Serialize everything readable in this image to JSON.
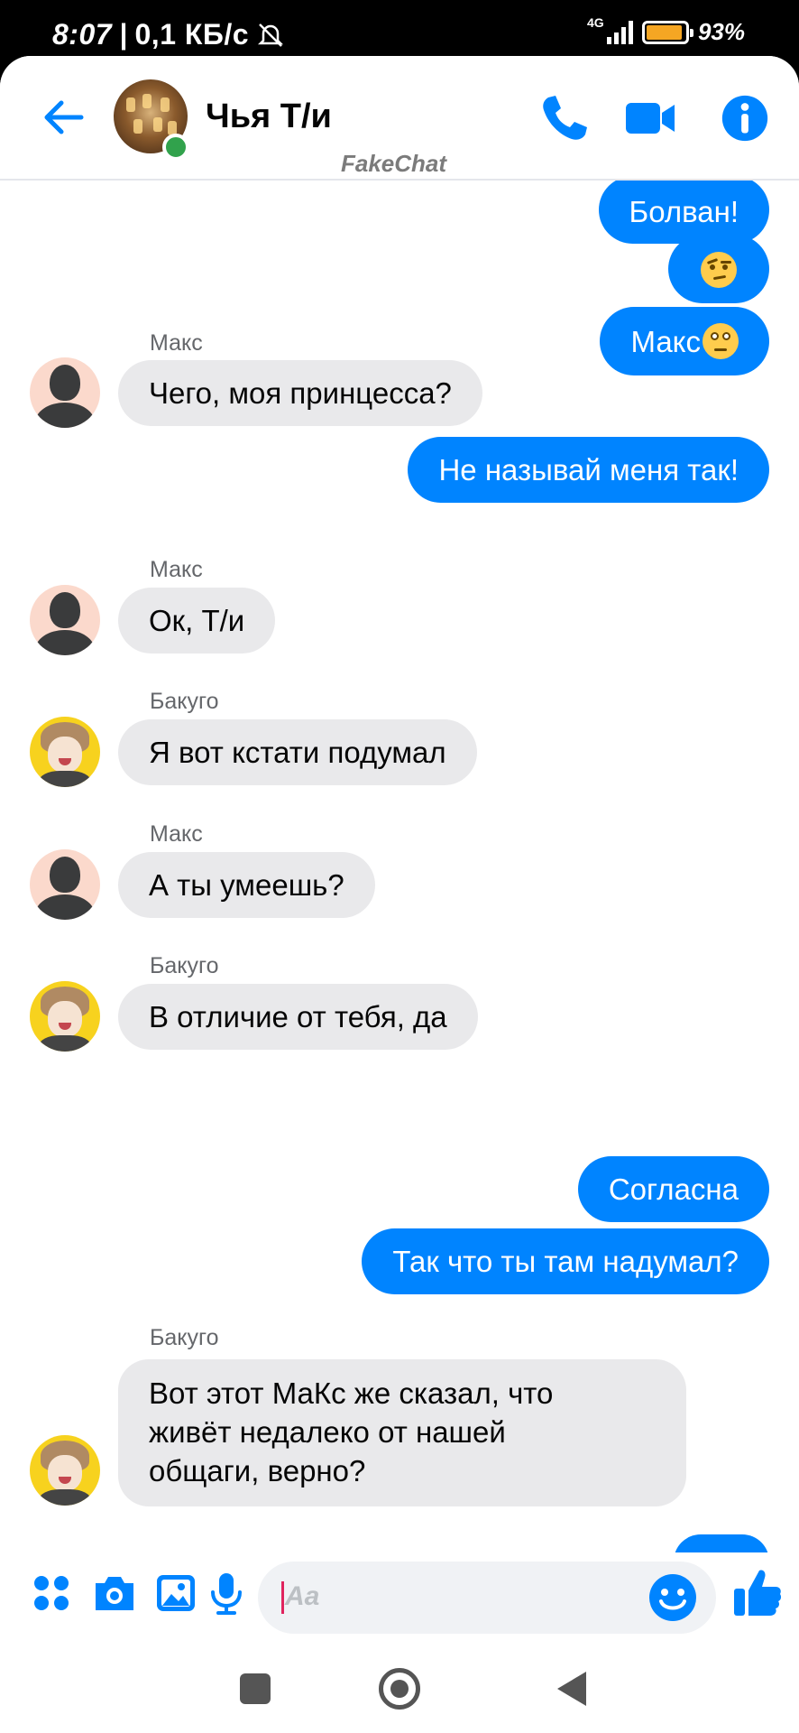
{
  "status_bar": {
    "time": "8:07",
    "network_speed": "0,1 КБ/с",
    "network_type": "4G",
    "battery_percent": "93%",
    "battery_level": 0.93,
    "battery_color": "#f5a623"
  },
  "header": {
    "title": "Чья Т/и",
    "watermark": "FakeChat",
    "online": true,
    "icons": [
      "back-arrow-icon",
      "phone-icon",
      "video-camera-icon",
      "info-icon"
    ]
  },
  "colors": {
    "accent": "#0084ff",
    "incoming_bubble": "#e9e9eb",
    "online_dot": "#31a24c"
  },
  "messages": [
    {
      "dir": "out",
      "text": "Болван!"
    },
    {
      "dir": "out",
      "emoji": "raised-eyebrow-emoji"
    },
    {
      "dir": "out",
      "text": "Макс",
      "emoji": "eye-roll-emoji"
    },
    {
      "dir": "in",
      "sender": "Макс",
      "text": "Чего, моя принцесса?"
    },
    {
      "dir": "out",
      "text": "Не называй меня так!"
    },
    {
      "dir": "in",
      "sender": "Макс",
      "text": "Ок, Т/и"
    },
    {
      "dir": "in",
      "sender": "Бакуго",
      "text": "Я вот кстати подумал"
    },
    {
      "dir": "in",
      "sender": "Макс",
      "text": "А ты умеешь?"
    },
    {
      "dir": "in",
      "sender": "Бакуго",
      "text": "В отличие от тебя, да"
    },
    {
      "dir": "out",
      "text": "Согласна"
    },
    {
      "dir": "out",
      "text": "Так что ты там надумал?"
    },
    {
      "dir": "in",
      "sender": "Бакуго",
      "lines": [
        "Вот этот МаКс же сказал, что",
        "живёт недалеко от нашей",
        "общаги, верно?"
      ]
    }
  ],
  "composer": {
    "placeholder": "Aa",
    "icons": [
      "apps-grid-icon",
      "camera-icon",
      "gallery-icon",
      "microphone-icon",
      "emoji-icon",
      "thumbs-up-icon"
    ]
  },
  "navigation_bar": {
    "icons": [
      "recents-square-icon",
      "home-circle-icon",
      "back-triangle-icon"
    ]
  }
}
